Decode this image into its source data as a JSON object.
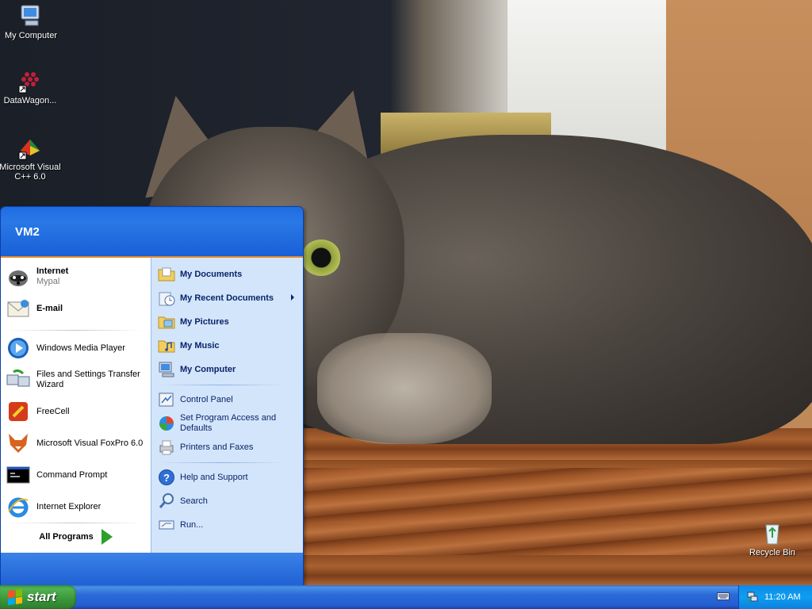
{
  "desktop": {
    "icons": [
      {
        "label": "My Computer",
        "icon": "my-computer-icon"
      },
      {
        "label": "DataWagon...",
        "icon": "datawagon-icon"
      },
      {
        "label": "Microsoft Visual C++ 6.0",
        "icon": "visual-cpp-icon"
      },
      {
        "label": "Recycle Bin",
        "icon": "recycle-bin-icon"
      }
    ]
  },
  "start_menu": {
    "user": "VM2",
    "left": {
      "pinned": [
        {
          "label": "Internet",
          "sub": "Mypal",
          "icon": "mypal-browser-icon"
        },
        {
          "label": "E-mail",
          "icon": "email-icon"
        }
      ],
      "recent": [
        {
          "label": "Windows Media Player",
          "icon": "media-player-icon"
        },
        {
          "label": "Files and Settings Transfer Wizard",
          "icon": "transfer-wizard-icon"
        },
        {
          "label": "FreeCell",
          "icon": "freecell-icon"
        },
        {
          "label": "Microsoft Visual FoxPro 6.0",
          "icon": "foxpro-icon"
        },
        {
          "label": "Command Prompt",
          "icon": "command-prompt-icon"
        },
        {
          "label": "Internet Explorer",
          "icon": "internet-explorer-icon"
        }
      ],
      "all_programs": "All Programs"
    },
    "right": {
      "places": [
        {
          "label": "My Documents",
          "icon": "folder-documents-icon"
        },
        {
          "label": "My Recent Documents",
          "icon": "recent-documents-icon"
        },
        {
          "label": "My Pictures",
          "icon": "folder-pictures-icon"
        },
        {
          "label": "My Music",
          "icon": "folder-music-icon"
        },
        {
          "label": "My Computer",
          "icon": "computer-icon"
        }
      ],
      "settings": [
        {
          "label": "Control Panel",
          "icon": "control-panel-icon"
        },
        {
          "label": "Set Program Access and Defaults",
          "icon": "program-defaults-icon"
        },
        {
          "label": "Printers and Faxes",
          "icon": "printer-icon"
        }
      ],
      "tools": [
        {
          "label": "Help and Support",
          "icon": "help-icon"
        },
        {
          "label": "Search",
          "icon": "search-icon"
        },
        {
          "label": "Run...",
          "icon": "run-icon"
        }
      ]
    }
  },
  "taskbar": {
    "start_label": "start",
    "clock": "11:20 AM"
  },
  "colors": {
    "xp_blue": "#245dd1",
    "start_green": "#3a963a",
    "menu_right_bg": "#d3e5fa",
    "tray_blue": "#0f9ef0"
  }
}
